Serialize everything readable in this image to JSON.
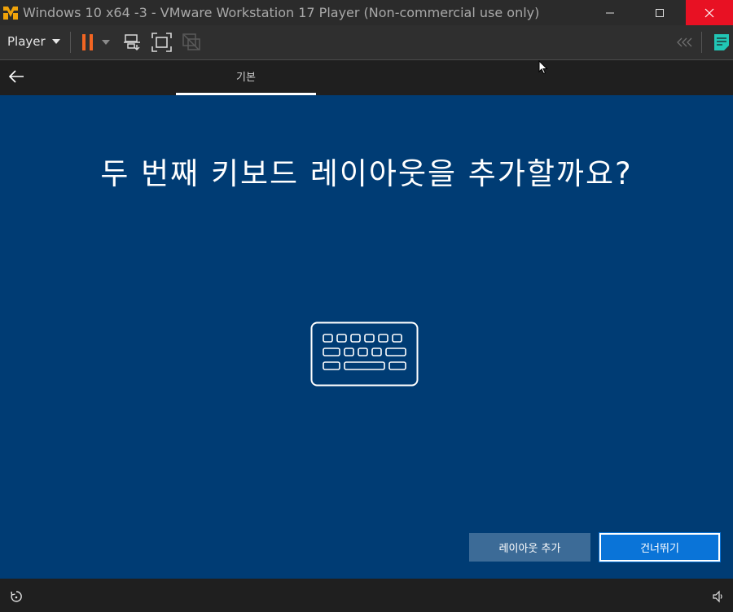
{
  "window": {
    "title": "Windows 10 x64 -3 - VMware Workstation 17 Player (Non-commercial use only)",
    "close_color": "#e81123"
  },
  "toolbar": {
    "player_menu_label": "Player",
    "pause_color": "#f26522"
  },
  "oobe": {
    "tab_label": "기본",
    "heading": "두 번째 키보드 레이아웃을 추가할까요?",
    "add_layout_button": "레이아웃 추가",
    "skip_button": "건너뛰기",
    "background_color": "#003c74",
    "illustration_icon": "keyboard-icon"
  },
  "icons": {
    "back": "back-arrow-icon",
    "ease_of_access": "ease-of-access-icon",
    "volume": "speaker-icon"
  }
}
